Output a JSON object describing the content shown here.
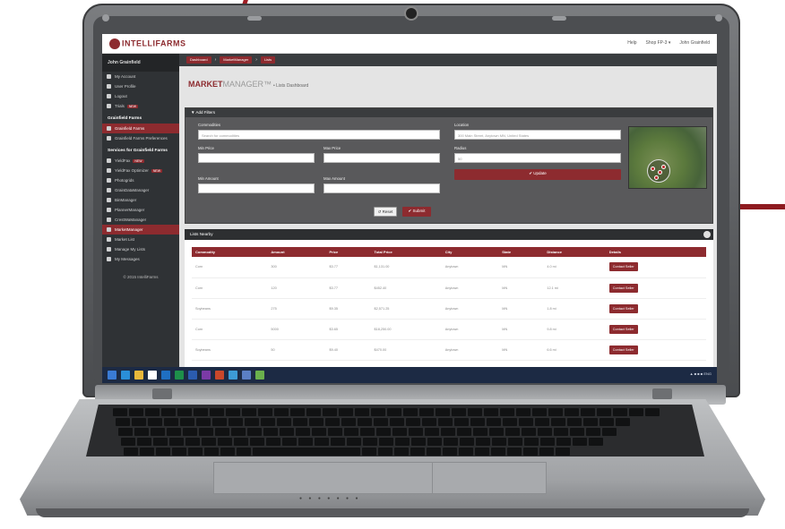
{
  "topbar": {
    "logo": "INTELLIFARMS",
    "links": [
      "Help",
      "Shop FP-3 ▾",
      "John Grainfield"
    ]
  },
  "sidebar": {
    "user": "John Grainfield",
    "items_top": [
      {
        "label": "My Account"
      },
      {
        "label": "User Profile"
      },
      {
        "label": "Logout"
      },
      {
        "label": "Trials",
        "badge": "NEW"
      }
    ],
    "section1": "Grainfield Farms",
    "items_mid": [
      {
        "label": "Grainfield Farms",
        "active": true
      },
      {
        "label": "Grainfield Farms Preferences"
      }
    ],
    "section2": "Services for Grainfield Farms",
    "items_services": [
      {
        "label": "YieldFax",
        "badge": "NEW"
      },
      {
        "label": "YieldFax Optimizer",
        "badge": "NEW"
      },
      {
        "label": "Photogrids"
      },
      {
        "label": "GrainDataManager"
      },
      {
        "label": "BinManager"
      },
      {
        "label": "PlannerManager"
      },
      {
        "label": "CrestWaManager"
      },
      {
        "label": "MarketManager",
        "active": true
      },
      {
        "label": "Market List"
      },
      {
        "label": "Manage My Lists"
      },
      {
        "label": "My Messages"
      }
    ],
    "footer": "© 2015 IntelliFarms"
  },
  "breadcrumb": [
    "Dashboard",
    "MarketManager",
    "Lists"
  ],
  "header": {
    "brand_bold": "MARKET",
    "brand_thin": "MANAGER™",
    "subtitle": "• Lists Dashboard"
  },
  "filters": {
    "title": "▼ Add Filters",
    "commodities_label": "Commodities",
    "commodities_placeholder": "Search for commodities",
    "min_price_label": "Min Price",
    "max_price_label": "Max Price",
    "min_amount_label": "Min Amount",
    "max_amount_label": "Max Amount",
    "reset": "↺ Reset",
    "submit": "✔ Submit",
    "location_label": "Location",
    "location_value": "300 Main Street, Anytown MN, United States",
    "radius_label": "Radius",
    "radius_value": "50",
    "update": "✔ Update"
  },
  "list": {
    "title": "Lists Nearby",
    "columns": [
      "Commodity",
      "Amount",
      "Price",
      "Total Price",
      "City",
      "State",
      "Distance",
      "Details"
    ],
    "rows": [
      [
        "Corn",
        "300",
        "$3.77",
        "$1,131.00",
        "Anytown",
        "MN",
        "4.0 mi",
        "Contact Seller"
      ],
      [
        "Corn",
        "120",
        "$3.77",
        "$452.40",
        "Anytown",
        "MN",
        "12.1 mi",
        "Contact Seller"
      ],
      [
        "Soybeans",
        "275",
        "$9.35",
        "$2,571.25",
        "Anytown",
        "MN",
        "1.8 mi",
        "Contact Seller"
      ],
      [
        "Corn",
        "5000",
        "$3.65",
        "$18,250.00",
        "Anytown",
        "MN",
        "9.8 mi",
        "Contact Seller"
      ],
      [
        "Soybeans",
        "50",
        "$9.40",
        "$470.00",
        "Anytown",
        "MN",
        "6.6 mi",
        "Contact Seller"
      ]
    ]
  },
  "taskbar": {
    "icons": [
      "windows-start",
      "internet-explorer",
      "file-explorer",
      "store",
      "outlook",
      "excel",
      "word",
      "onenote",
      "powerpoint",
      "lync",
      "photos",
      "app"
    ],
    "tray": "▲ ■ ■ ■ ENG"
  },
  "colors": {
    "accent": "#8d2b2f",
    "sidebar": "#2f3235",
    "filter_panel": "#59595b",
    "taskbar": "#1c2a44"
  }
}
